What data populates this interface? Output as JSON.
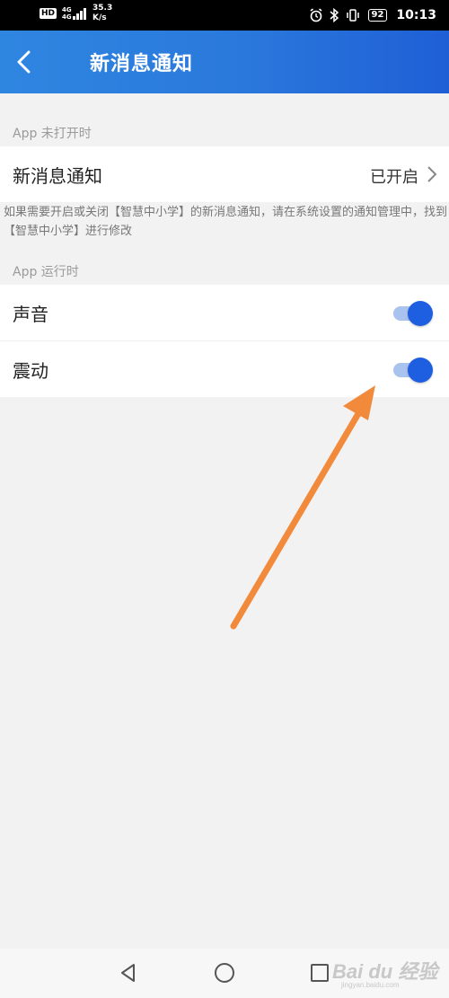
{
  "status_bar": {
    "hd_badge": "HD",
    "network_type": "4G 4G",
    "net_speed_value": "35.3",
    "net_speed_unit": "K/s",
    "battery": "92",
    "time": "10:13"
  },
  "header": {
    "title": "新消息通知"
  },
  "section_closed": {
    "header": "App 未打开时",
    "row_label": "新消息通知",
    "row_value": "已开启",
    "helper_text": "如果需要开启或关闭【智慧中小学】的新消息通知，请在系统设置的通知管理中，找到【智慧中小学】进行修改"
  },
  "section_running": {
    "header": "App 运行时",
    "sound_label": "声音",
    "sound_on": true,
    "vibration_label": "震动",
    "vibration_on": true
  },
  "watermark": {
    "text": "Bai du 经验",
    "sub": "jingyan.baidu.com"
  },
  "colors": {
    "header_start": "#2f86e0",
    "header_end": "#1f5fd6",
    "toggle_knob": "#1d5fe0",
    "toggle_track": "#a9c3ee",
    "arrow": "#f28a3c"
  }
}
